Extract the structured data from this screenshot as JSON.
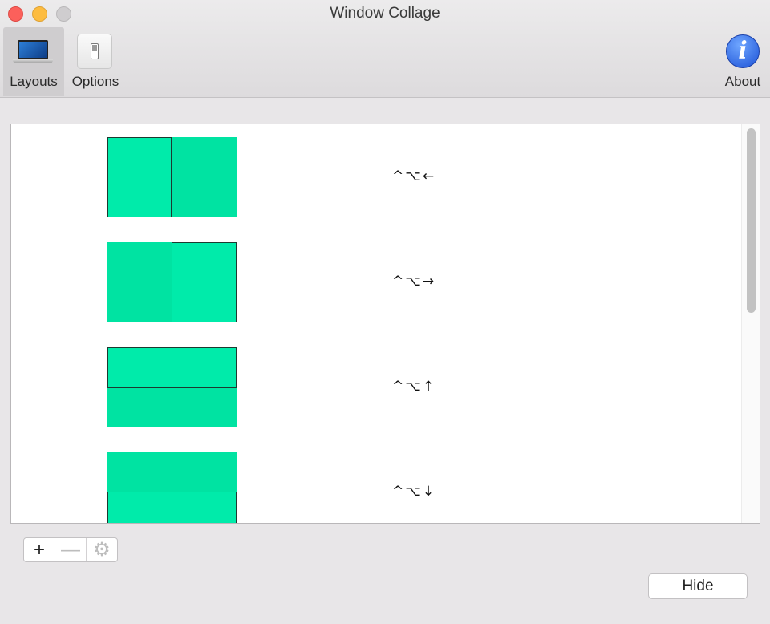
{
  "window": {
    "title": "Window Collage"
  },
  "toolbar": {
    "layouts_label": "Layouts",
    "options_label": "Options",
    "about_label": "About",
    "about_glyph": "i"
  },
  "layouts": [
    {
      "shortcut": "^⌥←"
    },
    {
      "shortcut": "^⌥→"
    },
    {
      "shortcut": "^⌥↑"
    },
    {
      "shortcut": "^⌥↓"
    }
  ],
  "controls": {
    "add_glyph": "+",
    "remove_glyph": "—",
    "gear_glyph": "⚙",
    "hide_label": "Hide"
  },
  "colors": {
    "accent_green": "#00e3a2",
    "close": "#fc605b",
    "minimize": "#fdbc40",
    "about_blue": "#1c52d6"
  }
}
